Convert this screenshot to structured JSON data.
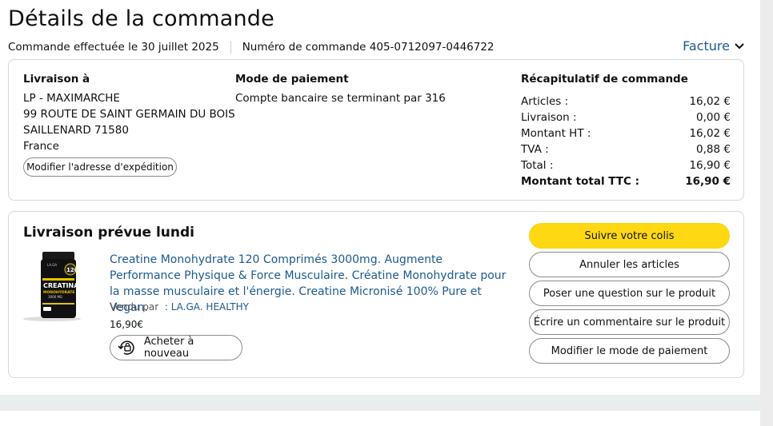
{
  "page": {
    "title": "Détails de la commande",
    "order_date": "Commande effectuée le 30 juillet 2025",
    "order_number": "Numéro de commande 405-0712097-0446722",
    "invoice_label": "Facture"
  },
  "shipping": {
    "title": "Livraison à",
    "lines": [
      "LP - MAXIMARCHE",
      "99 ROUTE DE SAINT GERMAIN DU BOIS",
      "SAILLENARD 71580",
      "France"
    ],
    "edit_button": "Modifier l'adresse d'expédition"
  },
  "payment": {
    "title": "Mode de paiement",
    "method": "Compte bancaire se terminant par 316"
  },
  "summary": {
    "title": "Récapitulatif de commande",
    "rows": [
      {
        "label": "Articles :",
        "value": "16,02 €"
      },
      {
        "label": "Livraison :",
        "value": "0,00 €"
      },
      {
        "label": "Montant HT :",
        "value": "16,02 €"
      },
      {
        "label": "TVA :",
        "value": "0,88 €"
      },
      {
        "label": "Total :",
        "value": "16,90 €"
      },
      {
        "label": "Montant total TTC :",
        "value": "16,90 €"
      }
    ]
  },
  "delivery": {
    "title": "Livraison prévue lundi",
    "product_title": "Creatine Monohydrate 120 Comprimés 3000mg. Augmente Performance Physique & Force Musculaire. Créatine Monohydrate pour la masse musculaire et l'énergie. Creatine Micronisé 100% Pure et Vegan.",
    "sold_by_label": "Vendu par",
    "seller": ": LA.GA. HEALTHY",
    "price": "16,90€",
    "rebuy_button": "Acheter à nouveau",
    "image_text": {
      "brand": "LA.GA",
      "name": "CREATINA",
      "sub": "MONOHYDRATE",
      "dose": "3000 MG",
      "count": "120"
    }
  },
  "actions": {
    "track": "Suivre votre colis",
    "cancel": "Annuler les articles",
    "question": "Poser une question sur le produit",
    "review": "Écrire un commentaire sur le produit",
    "payment_change": "Modifier le mode de paiement"
  },
  "colors": {
    "link": "#1d5a8f",
    "primary_button": "#ffd814",
    "border": "#d5d9d9"
  }
}
